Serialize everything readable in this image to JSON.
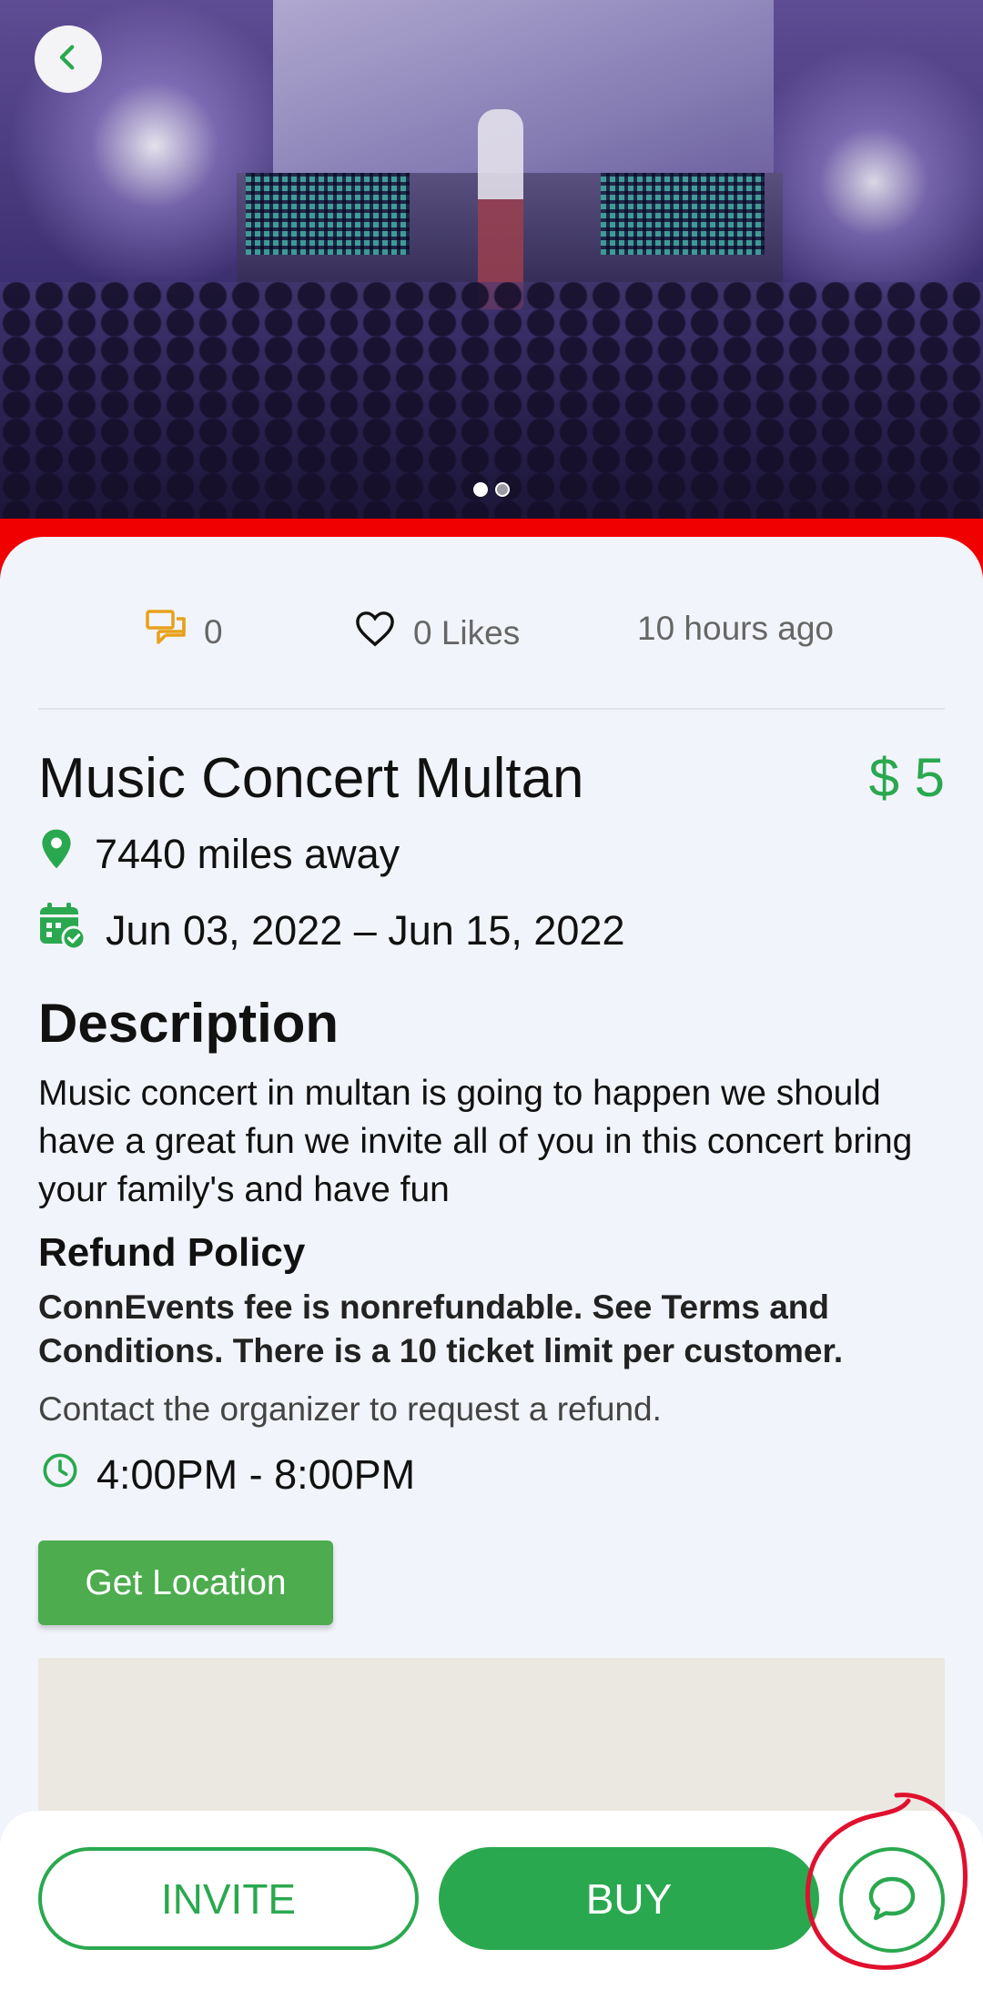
{
  "hero": {
    "image_alt": "Music concert stage with crowd",
    "carousel": {
      "total": 2,
      "active": 1
    }
  },
  "stats": {
    "comments": "0",
    "likes": "0 Likes",
    "posted": "10 hours ago"
  },
  "event": {
    "title": "Music Concert Multan",
    "price": "$ 5",
    "distance": "7440 miles away",
    "dates": "Jun 03, 2022 – Jun 15, 2022",
    "description_heading": "Description",
    "description": "Music concert in multan is going to happen we should have a great fun we invite all of you in this concert bring your family's and have fun",
    "refund_heading": "Refund Policy",
    "refund_policy": "ConnEvents fee is nonrefundable. See Terms and Conditions. There is a 10 ticket limit per customer.",
    "refund_contact": "Contact the organizer to request a refund.",
    "time": "4:00PM - 8:00PM"
  },
  "actions": {
    "get_location": "Get Location",
    "invite": "INVITE",
    "buy": "BUY"
  },
  "icons": {
    "back": "chevron-left-icon",
    "comments": "comments-icon",
    "likes": "heart-icon",
    "location": "location-pin-icon",
    "calendar": "calendar-check-icon",
    "clock": "clock-icon",
    "chat": "chat-bubble-icon"
  },
  "colors": {
    "accent": "#2aa84f",
    "button_green": "#4cac4e",
    "comment_icon": "#e7a11a",
    "highlight_red": "#f10000",
    "annotation_red": "#e0102e"
  }
}
